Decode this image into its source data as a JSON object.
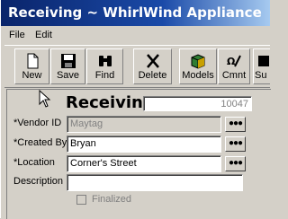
{
  "window": {
    "title": "Receiving ~ WhirlWind Appliance"
  },
  "menu": {
    "file": "File",
    "edit": "Edit"
  },
  "toolbar": {
    "new": "New",
    "save": "Save",
    "find": "Find",
    "delete": "Delete",
    "models": "Models",
    "comment": "Cmnt",
    "partial": "Su"
  },
  "form": {
    "heading": "Receiving",
    "record_number": "10047",
    "vendor_label": "*Vendor ID",
    "vendor_value": "Maytag",
    "created_by_label": "*Created By",
    "created_by_value": "Bryan",
    "location_label": "*Location",
    "location_value": "Corner's Street",
    "description_label": "Description",
    "description_value": "",
    "lookup_button": "●●●",
    "finalized_label": "Finalized"
  }
}
